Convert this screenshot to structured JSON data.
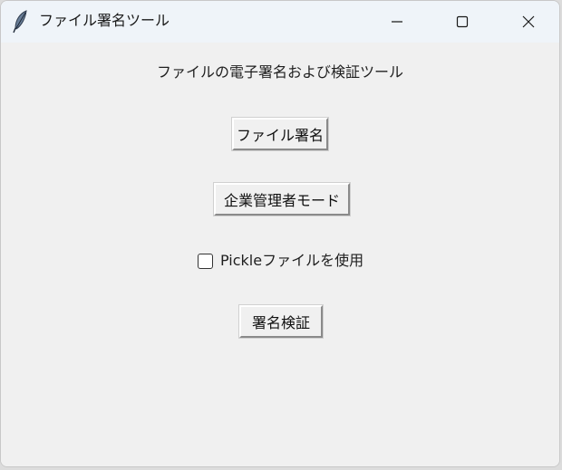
{
  "window": {
    "title": "ファイル署名ツール",
    "icons": {
      "app": "feather-icon",
      "minimize": "minimize-icon",
      "maximize": "maximize-icon",
      "close": "close-icon"
    }
  },
  "main": {
    "heading": "ファイルの電子署名および検証ツール",
    "sign_button": "ファイル署名",
    "admin_button": "企業管理者モード",
    "pickle_checkbox": {
      "label": "Pickleファイルを使用",
      "checked": false
    },
    "verify_button": "署名検証"
  },
  "colors": {
    "titlebar": "#eff4f9",
    "client_bg": "#f0f0f0",
    "text": "#1f1f1f"
  }
}
